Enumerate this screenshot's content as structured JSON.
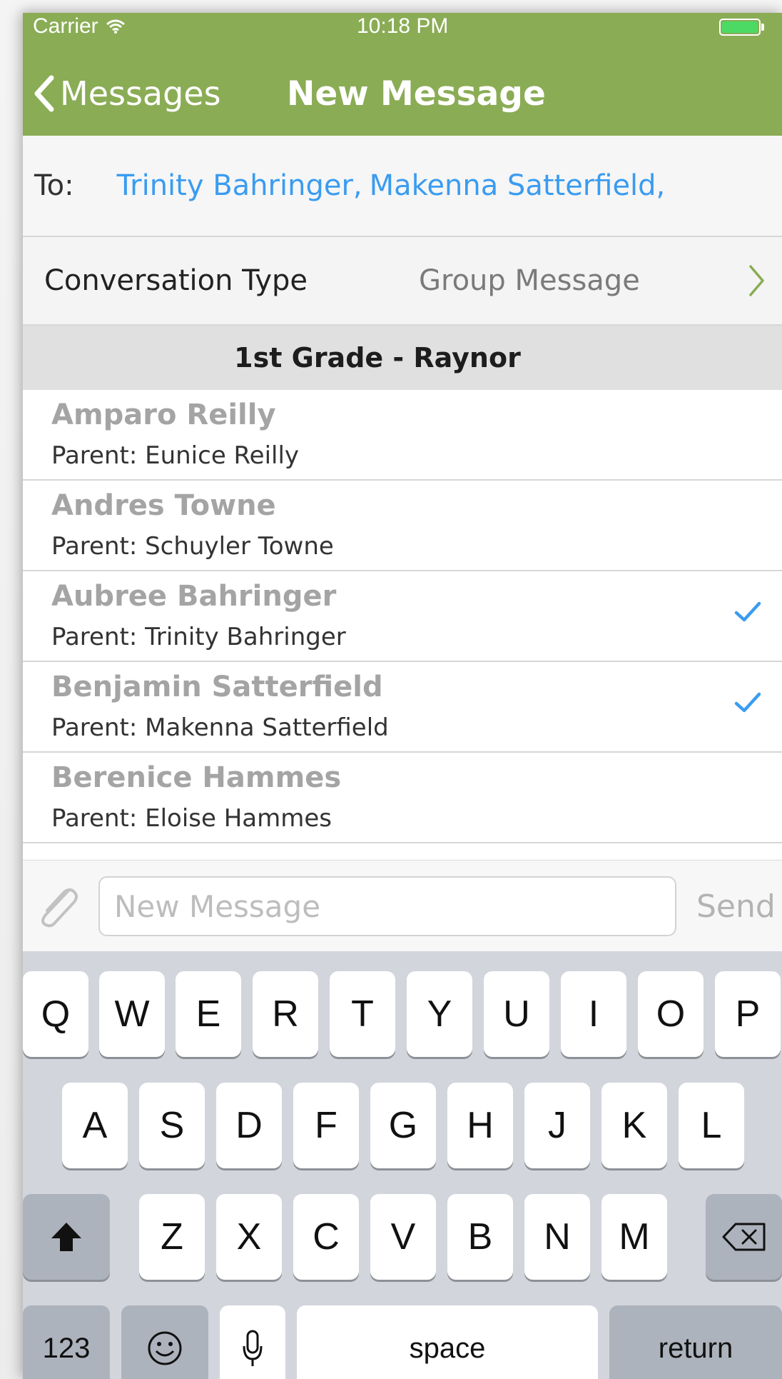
{
  "status_bar": {
    "carrier": "Carrier",
    "time": "10:18 PM"
  },
  "nav": {
    "back_label": "Messages",
    "title": "New Message"
  },
  "to_row": {
    "label": "To:",
    "recipients": [
      "Trinity Bahringer,",
      "Makenna Satterfield,"
    ]
  },
  "conversation": {
    "label": "Conversation Type",
    "value": "Group Message"
  },
  "section": {
    "title": "1st Grade - Raynor"
  },
  "students": [
    {
      "name": "Amparo Reilly",
      "parent": "Parent: Eunice Reilly",
      "checked": false
    },
    {
      "name": "Andres Towne",
      "parent": "Parent: Schuyler Towne",
      "checked": false
    },
    {
      "name": "Aubree Bahringer",
      "parent": "Parent: Trinity Bahringer",
      "checked": true
    },
    {
      "name": "Benjamin Satterfield",
      "parent": "Parent: Makenna Satterfield",
      "checked": true
    },
    {
      "name": "Berenice Hammes",
      "parent": "Parent: Eloise Hammes",
      "checked": false
    }
  ],
  "composer": {
    "placeholder": "New Message",
    "send_label": "Send"
  },
  "keyboard": {
    "row1": [
      "Q",
      "W",
      "E",
      "R",
      "T",
      "Y",
      "U",
      "I",
      "O",
      "P"
    ],
    "row2": [
      "A",
      "S",
      "D",
      "F",
      "G",
      "H",
      "J",
      "K",
      "L"
    ],
    "row3": [
      "Z",
      "X",
      "C",
      "V",
      "B",
      "N",
      "M"
    ],
    "numbers_label": "123",
    "space_label": "space",
    "return_label": "return"
  },
  "colors": {
    "nav_green": "#8aac55",
    "link_blue": "#3a9cf0",
    "check_blue": "#3a9cf0"
  }
}
